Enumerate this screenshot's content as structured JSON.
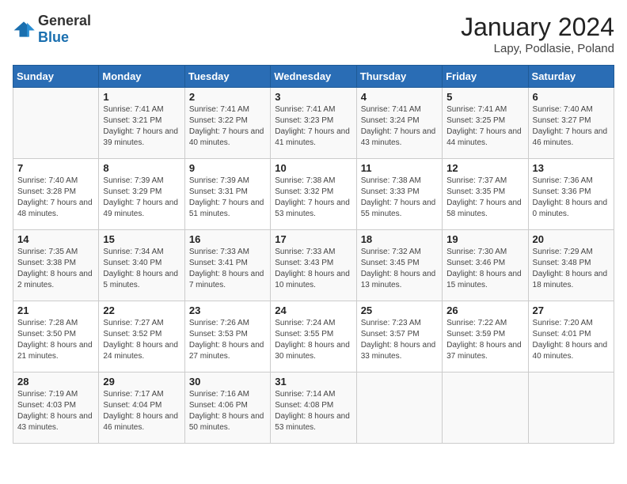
{
  "header": {
    "logo_general": "General",
    "logo_blue": "Blue",
    "month": "January 2024",
    "location": "Lapy, Podlasie, Poland"
  },
  "days_of_week": [
    "Sunday",
    "Monday",
    "Tuesday",
    "Wednesday",
    "Thursday",
    "Friday",
    "Saturday"
  ],
  "weeks": [
    [
      {
        "day": null
      },
      {
        "day": "1",
        "sunrise": "7:41 AM",
        "sunset": "3:21 PM",
        "daylight": "7 hours and 39 minutes."
      },
      {
        "day": "2",
        "sunrise": "7:41 AM",
        "sunset": "3:22 PM",
        "daylight": "7 hours and 40 minutes."
      },
      {
        "day": "3",
        "sunrise": "7:41 AM",
        "sunset": "3:23 PM",
        "daylight": "7 hours and 41 minutes."
      },
      {
        "day": "4",
        "sunrise": "7:41 AM",
        "sunset": "3:24 PM",
        "daylight": "7 hours and 43 minutes."
      },
      {
        "day": "5",
        "sunrise": "7:41 AM",
        "sunset": "3:25 PM",
        "daylight": "7 hours and 44 minutes."
      },
      {
        "day": "6",
        "sunrise": "7:40 AM",
        "sunset": "3:27 PM",
        "daylight": "7 hours and 46 minutes."
      }
    ],
    [
      {
        "day": "7",
        "sunrise": "7:40 AM",
        "sunset": "3:28 PM",
        "daylight": "7 hours and 48 minutes."
      },
      {
        "day": "8",
        "sunrise": "7:39 AM",
        "sunset": "3:29 PM",
        "daylight": "7 hours and 49 minutes."
      },
      {
        "day": "9",
        "sunrise": "7:39 AM",
        "sunset": "3:31 PM",
        "daylight": "7 hours and 51 minutes."
      },
      {
        "day": "10",
        "sunrise": "7:38 AM",
        "sunset": "3:32 PM",
        "daylight": "7 hours and 53 minutes."
      },
      {
        "day": "11",
        "sunrise": "7:38 AM",
        "sunset": "3:33 PM",
        "daylight": "7 hours and 55 minutes."
      },
      {
        "day": "12",
        "sunrise": "7:37 AM",
        "sunset": "3:35 PM",
        "daylight": "7 hours and 58 minutes."
      },
      {
        "day": "13",
        "sunrise": "7:36 AM",
        "sunset": "3:36 PM",
        "daylight": "8 hours and 0 minutes."
      }
    ],
    [
      {
        "day": "14",
        "sunrise": "7:35 AM",
        "sunset": "3:38 PM",
        "daylight": "8 hours and 2 minutes."
      },
      {
        "day": "15",
        "sunrise": "7:34 AM",
        "sunset": "3:40 PM",
        "daylight": "8 hours and 5 minutes."
      },
      {
        "day": "16",
        "sunrise": "7:33 AM",
        "sunset": "3:41 PM",
        "daylight": "8 hours and 7 minutes."
      },
      {
        "day": "17",
        "sunrise": "7:33 AM",
        "sunset": "3:43 PM",
        "daylight": "8 hours and 10 minutes."
      },
      {
        "day": "18",
        "sunrise": "7:32 AM",
        "sunset": "3:45 PM",
        "daylight": "8 hours and 13 minutes."
      },
      {
        "day": "19",
        "sunrise": "7:30 AM",
        "sunset": "3:46 PM",
        "daylight": "8 hours and 15 minutes."
      },
      {
        "day": "20",
        "sunrise": "7:29 AM",
        "sunset": "3:48 PM",
        "daylight": "8 hours and 18 minutes."
      }
    ],
    [
      {
        "day": "21",
        "sunrise": "7:28 AM",
        "sunset": "3:50 PM",
        "daylight": "8 hours and 21 minutes."
      },
      {
        "day": "22",
        "sunrise": "7:27 AM",
        "sunset": "3:52 PM",
        "daylight": "8 hours and 24 minutes."
      },
      {
        "day": "23",
        "sunrise": "7:26 AM",
        "sunset": "3:53 PM",
        "daylight": "8 hours and 27 minutes."
      },
      {
        "day": "24",
        "sunrise": "7:24 AM",
        "sunset": "3:55 PM",
        "daylight": "8 hours and 30 minutes."
      },
      {
        "day": "25",
        "sunrise": "7:23 AM",
        "sunset": "3:57 PM",
        "daylight": "8 hours and 33 minutes."
      },
      {
        "day": "26",
        "sunrise": "7:22 AM",
        "sunset": "3:59 PM",
        "daylight": "8 hours and 37 minutes."
      },
      {
        "day": "27",
        "sunrise": "7:20 AM",
        "sunset": "4:01 PM",
        "daylight": "8 hours and 40 minutes."
      }
    ],
    [
      {
        "day": "28",
        "sunrise": "7:19 AM",
        "sunset": "4:03 PM",
        "daylight": "8 hours and 43 minutes."
      },
      {
        "day": "29",
        "sunrise": "7:17 AM",
        "sunset": "4:04 PM",
        "daylight": "8 hours and 46 minutes."
      },
      {
        "day": "30",
        "sunrise": "7:16 AM",
        "sunset": "4:06 PM",
        "daylight": "8 hours and 50 minutes."
      },
      {
        "day": "31",
        "sunrise": "7:14 AM",
        "sunset": "4:08 PM",
        "daylight": "8 hours and 53 minutes."
      },
      {
        "day": null
      },
      {
        "day": null
      },
      {
        "day": null
      }
    ]
  ]
}
